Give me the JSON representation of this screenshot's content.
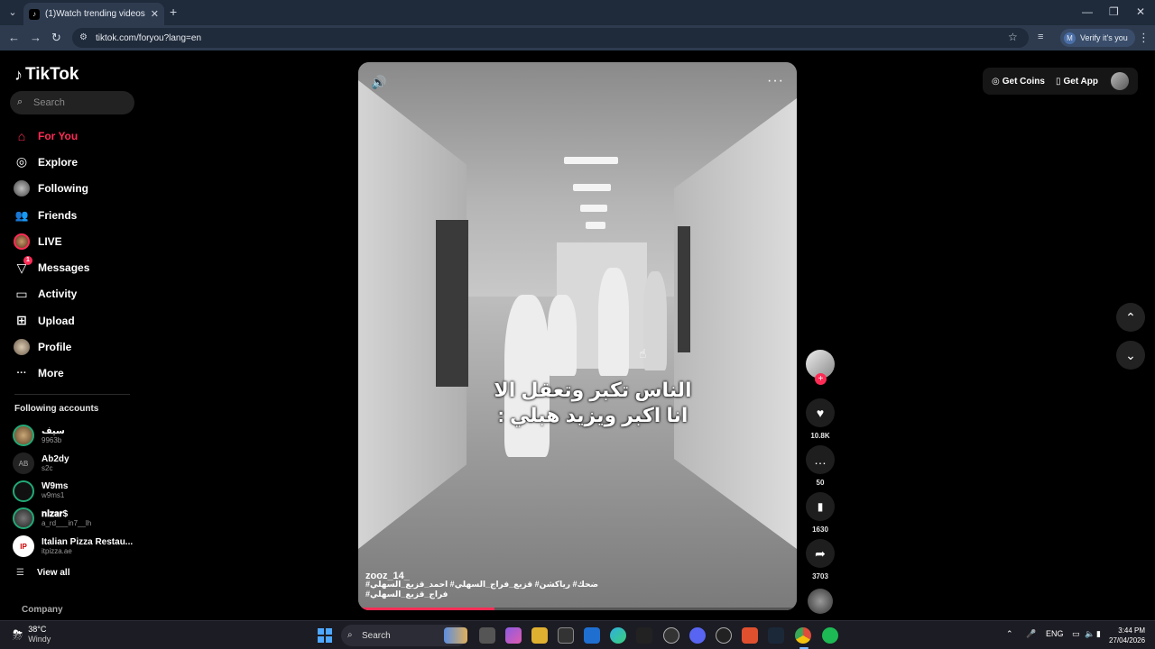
{
  "browser": {
    "tab_title": "(1)Watch trending videos for yo",
    "tab_close": "✕",
    "new_tab": "+",
    "url": "tiktok.com/foryou?lang=en",
    "profile_initial": "M",
    "profile_label": "Verify it's you",
    "icons": {
      "tab_list": "⌄",
      "back": "←",
      "forward": "→",
      "reload": "↻",
      "site_info": "⚙",
      "bookmark": "☆",
      "reading_list": "≡",
      "menu": "⋮",
      "minimize": "—",
      "maximize": "❐",
      "close": "✕"
    }
  },
  "tiktok": {
    "logo": "TikTok",
    "logo_icon": "♪",
    "search_placeholder": "Search",
    "search_icon": "⌕",
    "nav": [
      {
        "label": "For You",
        "icon": "⌂"
      },
      {
        "label": "Explore",
        "icon": "◎"
      },
      {
        "label": "Following",
        "icon": ""
      },
      {
        "label": "Friends",
        "icon": "👥"
      },
      {
        "label": "LIVE",
        "icon": ""
      },
      {
        "label": "Messages",
        "icon": "▽",
        "badge": "1"
      },
      {
        "label": "Activity",
        "icon": "▭"
      },
      {
        "label": "Upload",
        "icon": "⊞"
      },
      {
        "label": "Profile",
        "icon": ""
      },
      {
        "label": "More",
        "icon": "···"
      }
    ],
    "following_title": "Following accounts",
    "following": [
      {
        "name": "سيف",
        "handle": "9963b",
        "avatar": ""
      },
      {
        "name": "Ab2dy",
        "handle": "s2c",
        "avatar": "AB"
      },
      {
        "name": "W9ms",
        "handle": "w9ms1",
        "avatar": ""
      },
      {
        "name": "𝐧𝐢𝐳𝐚𝐫$",
        "handle": "a_rd___in7__lh",
        "avatar": ""
      },
      {
        "name": "Italian Pizza Restau...",
        "handle": "itpizza.ae",
        "avatar": "IP"
      }
    ],
    "view_all": "View all",
    "view_all_icon": "☰",
    "company": "Company"
  },
  "video": {
    "caption_line1": "الناس تكبر وتعقل الا",
    "caption_line2": "انا اكبر ويزيد هبلي :",
    "author": "zooz_14_",
    "hashtags": "ضحك# رياكشن# قزيع_فراج_السهلي# احمد_قزيع_السهلي# فراج_قزيع_السهلي#",
    "progress": 0.31,
    "sound_icon": "🔊",
    "more_icon": "···"
  },
  "actions": {
    "follow_plus": "+",
    "like_icon": "♥",
    "likes": "10.8K",
    "comment_icon": "…",
    "comments": "50",
    "save_icon": "▮",
    "saves": "1630",
    "share_icon": "➦",
    "shares": "3703"
  },
  "topbar": {
    "get_coins": "Get Coins",
    "coins_icon": "◎",
    "get_app": "Get App",
    "app_icon": "▯"
  },
  "scroll": {
    "up": "⌃",
    "down": "⌄"
  },
  "taskbar": {
    "weather_icon": "⛈",
    "temp": "38°C",
    "condition": "Windy",
    "search": "Search",
    "search_icon": "⌕",
    "tray_caret": "⌃",
    "mic_icon": "🎤",
    "lang": "ENG",
    "tray_display_icon": "▭",
    "tray_volume_icon": "🔈",
    "tray_battery_icon": "▮",
    "time": "3:44 PM",
    "date": "27/04/2026"
  }
}
